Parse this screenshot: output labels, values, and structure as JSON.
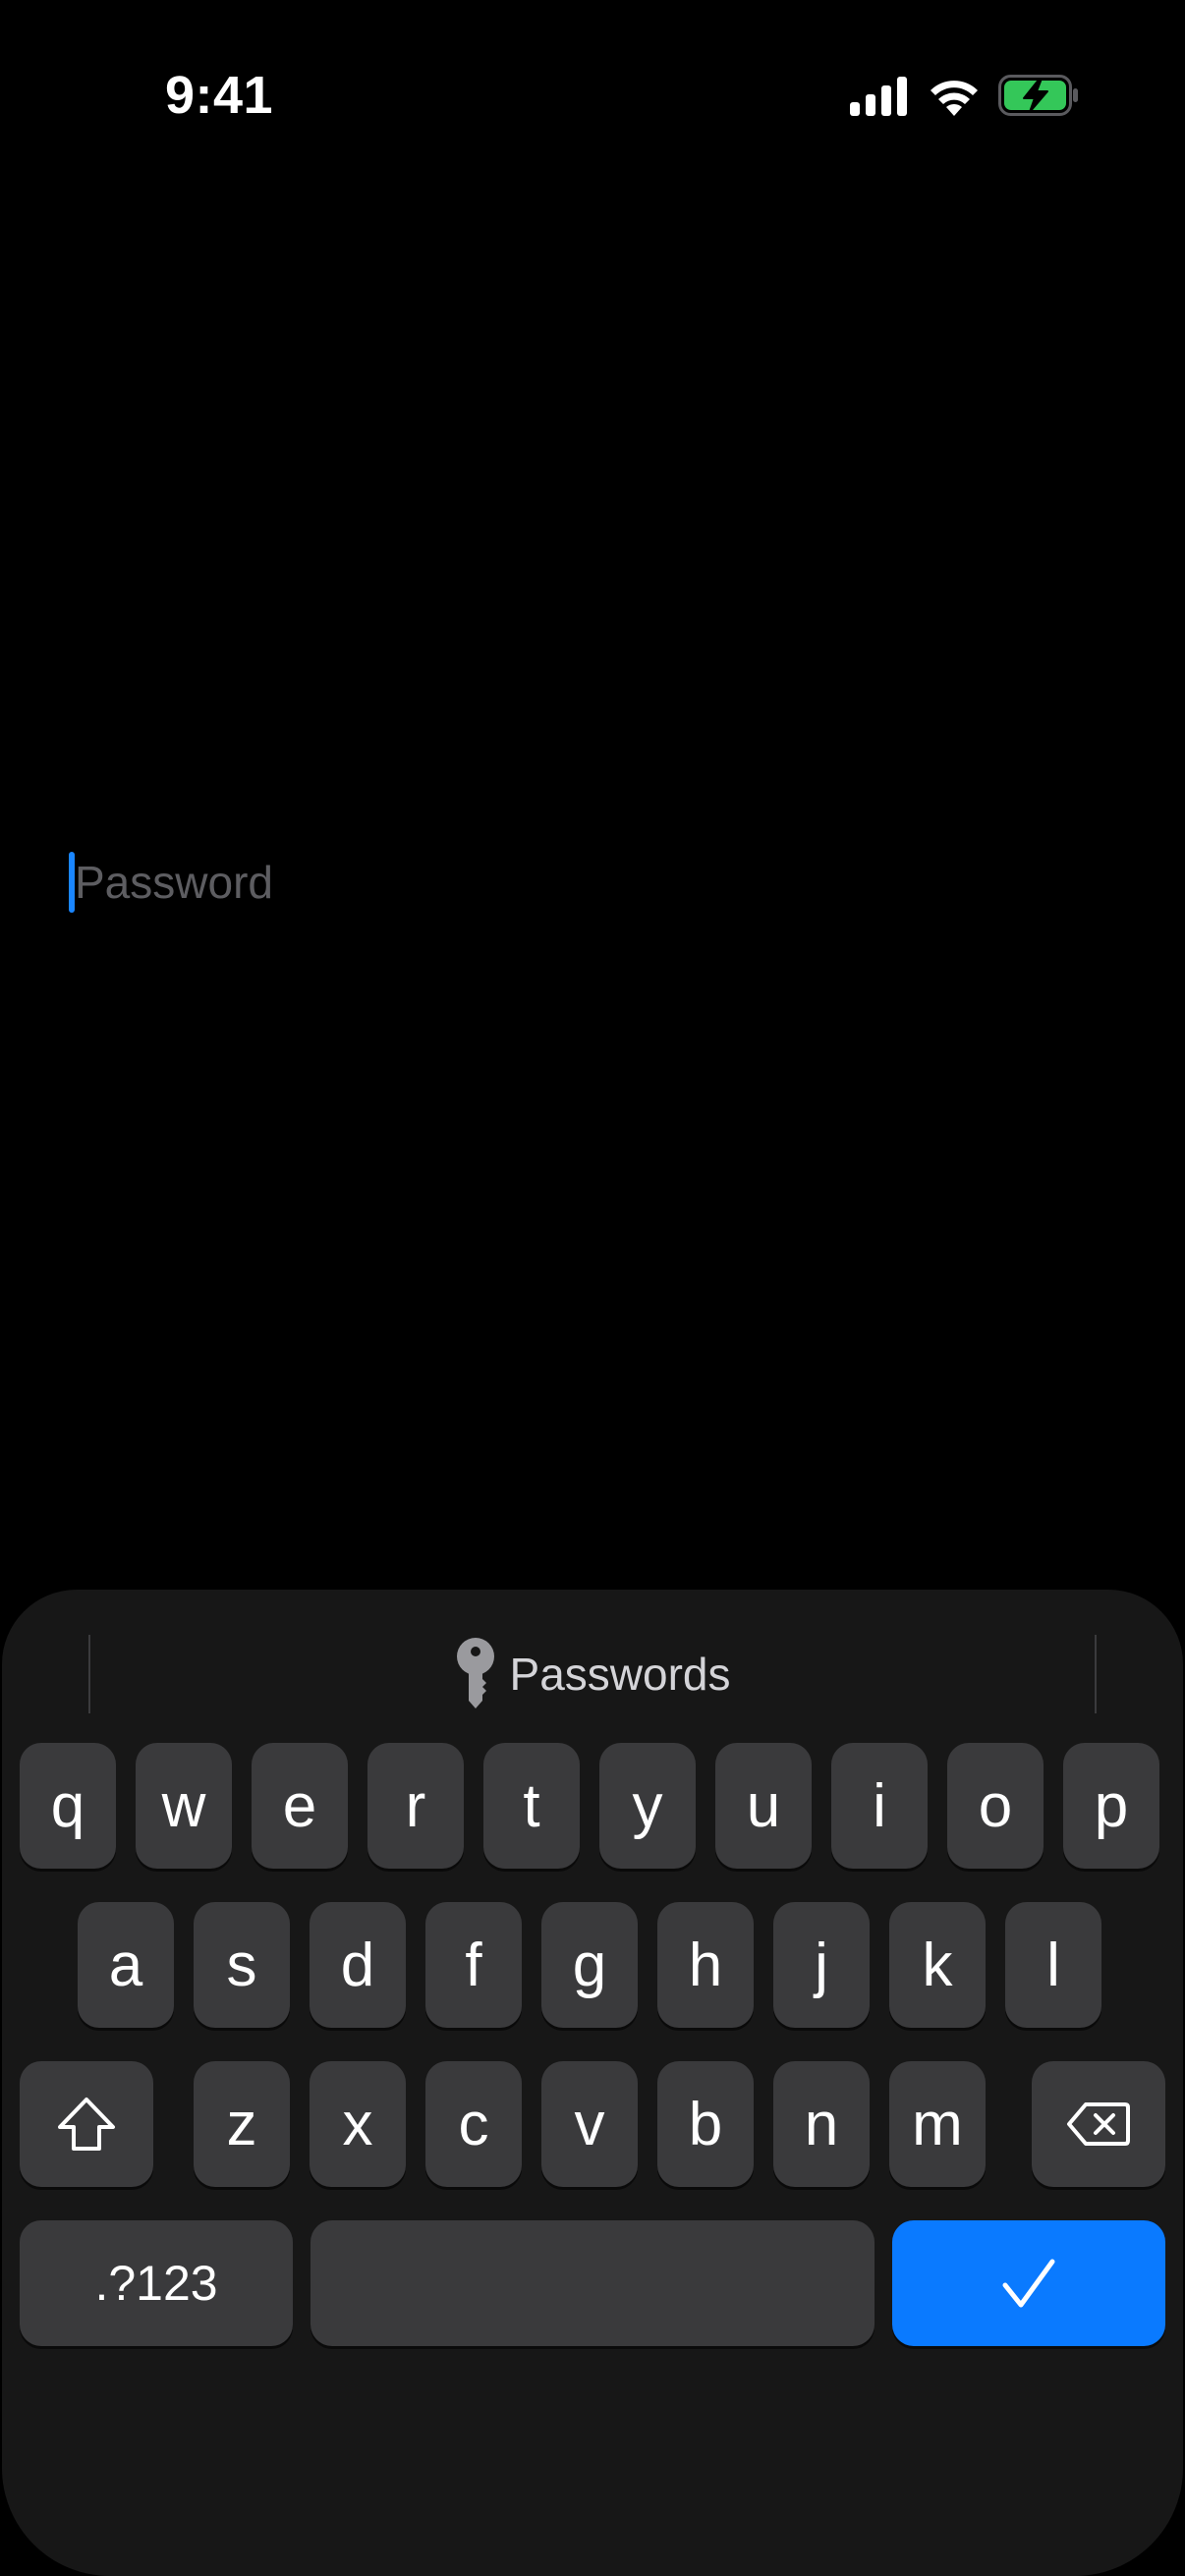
{
  "status_bar": {
    "time": "9:41",
    "signal_icon": "cellular-signal-icon",
    "wifi_icon": "wifi-icon",
    "battery_icon": "battery-charging-icon",
    "battery_color": "#34c759"
  },
  "password_field": {
    "placeholder": "Password",
    "caret_color": "#1a86ff"
  },
  "keyboard": {
    "autofill_label": "Passwords",
    "autofill_icon": "key-icon",
    "row1": [
      "q",
      "w",
      "e",
      "r",
      "t",
      "y",
      "u",
      "i",
      "o",
      "p"
    ],
    "row2": [
      "a",
      "s",
      "d",
      "f",
      "g",
      "h",
      "j",
      "k",
      "l"
    ],
    "row3": [
      "z",
      "x",
      "c",
      "v",
      "b",
      "n",
      "m"
    ],
    "shift_icon": "shift-icon",
    "delete_icon": "delete-backspace-icon",
    "numbers_label": ".?123",
    "space_label": "",
    "return_icon": "checkmark-icon",
    "return_color": "#0a7aff"
  }
}
